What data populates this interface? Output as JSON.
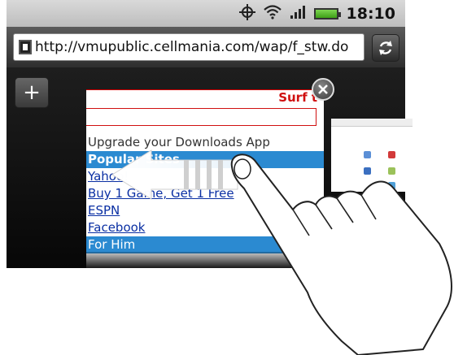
{
  "status_bar": {
    "time": "18:10",
    "icons": [
      "gps-icon",
      "wifi-icon",
      "signal-icon",
      "battery-icon"
    ]
  },
  "url_bar": {
    "url": "http://vmupublic.cellmania.com/wap/f_stw.do"
  },
  "tabs": {
    "current_page": {
      "header_text": "Surf t",
      "rows": [
        {
          "text": "Upgrade your Downloads App",
          "style": "plain"
        },
        {
          "text": "Popular Sites",
          "style": "selected"
        },
        {
          "text": "Yahoo!",
          "style": "link"
        },
        {
          "text": "Buy 1 Game, Get 1 Free",
          "style": "link"
        },
        {
          "text": "ESPN",
          "style": "link"
        },
        {
          "text": "Facebook",
          "style": "link"
        },
        {
          "text": "For Him",
          "style": "selected-plain"
        }
      ]
    }
  },
  "colors": {
    "selected_row": "#2b8ad1",
    "link": "#0a2fa3",
    "header_accent": "#d01010"
  }
}
